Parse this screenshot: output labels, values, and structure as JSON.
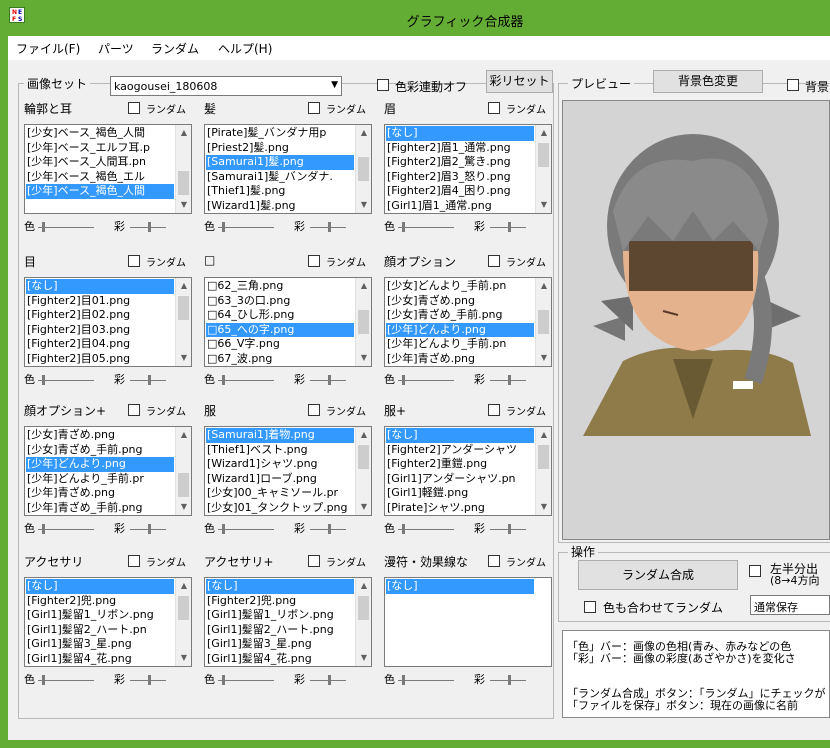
{
  "window": {
    "title": "グラフィック合成器"
  },
  "menu": [
    {
      "label": "ファイル(F)"
    },
    {
      "label": "パーツ"
    },
    {
      "label": "ランダム"
    },
    {
      "label": "ヘルプ(H)"
    }
  ],
  "image_set": {
    "group_title": "画像セット",
    "value": "kaogousei_180608",
    "color_link_label": "色彩連動オフ",
    "saturation_set_button": "彩リセット"
  },
  "random_label": "ランダム",
  "color_label": "色",
  "saturation_label": "彩",
  "parts": [
    {
      "label": "輪郭と耳",
      "items": [
        "[少女]ベース_褐色_人間",
        "[少年]ベース_エルフ耳.p",
        "[少年]ベース_人間耳.pn",
        "[少年]ベース_褐色_エル",
        "[少年]ベース_褐色_人間"
      ],
      "selected": 4,
      "scroll": "bottom"
    },
    {
      "label": "髪",
      "items": [
        "[Pirate]髪_バンダナ用p",
        "[Priest2]髪.png",
        "[Samurai1]髪.png",
        "[Samurai1]髪_バンダナ.",
        "[Thief1]髪.png",
        "[Wizard1]髪.png"
      ],
      "selected": 2,
      "scroll": "mid"
    },
    {
      "label": "眉",
      "items": [
        "[なし]",
        "[Fighter2]眉1_通常.png",
        "[Fighter2]眉2_驚き.png",
        "[Fighter2]眉3_怒り.png",
        "[Fighter2]眉4_困り.png",
        "[Girl1]眉1_通常.png"
      ],
      "selected": 0,
      "scroll": "top"
    },
    {
      "label": "目",
      "items": [
        "[なし]",
        "[Fighter2]目01.png",
        "[Fighter2]目02.png",
        "[Fighter2]目03.png",
        "[Fighter2]目04.png",
        "[Fighter2]目05.png"
      ],
      "selected": 0,
      "scroll": "top"
    },
    {
      "label": "□",
      "items": [
        "□62_三角.png",
        "□63_3の口.png",
        "□64_ひし形.png",
        "□65_への字.png",
        "□66_V字.png",
        "□67_波.png"
      ],
      "selected": 3,
      "scroll": "mid"
    },
    {
      "label": "顔オプション",
      "items": [
        "[少女]どんより_手前.pn",
        "[少女]青ざめ.png",
        "[少女]青ざめ_手前.png",
        "[少年]どんより.png",
        "[少年]どんより_手前.pn",
        "[少年]青ざめ.png"
      ],
      "selected": 3,
      "scroll": "mid"
    },
    {
      "label": "顔オプション+",
      "items": [
        "[少女]青ざめ.png",
        "[少女]青ざめ_手前.png",
        "[少年]どんより.png",
        "[少年]どんより_手前.pr",
        "[少年]青ざめ.png",
        "[少年]青ざめ_手前.png"
      ],
      "selected": 2,
      "scroll": "bottom"
    },
    {
      "label": "服",
      "items": [
        "[Samurai1]着物.png",
        "[Thief1]ベスト.png",
        "[Wizard1]シャツ.png",
        "[Wizard1]ローブ.png",
        "[少女]00_キャミソール.pr",
        "[少女]01_タンクトップ.png"
      ],
      "selected": 0,
      "scroll": "top"
    },
    {
      "label": "服+",
      "items": [
        "[なし]",
        "[Fighter2]アンダーシャツ",
        "[Fighter2]重鎧.png",
        "[Girl1]アンダーシャツ.pn",
        "[Girl1]軽鎧.png",
        "[Pirate]シャツ.png"
      ],
      "selected": 0,
      "scroll": "top"
    },
    {
      "label": "アクセサリ",
      "items": [
        "[なし]",
        "[Fighter2]兜.png",
        "[Girl1]髪留1_リボン.png",
        "[Girl1]髪留2_ハート.pn",
        "[Girl1]髪留3_星.png",
        "[Girl1]髪留4_花.png"
      ],
      "selected": 0,
      "scroll": "top"
    },
    {
      "label": "アクセサリ+",
      "items": [
        "[なし]",
        "[Fighter2]兜.png",
        "[Girl1]髪留1_リボン.png",
        "[Girl1]髪留2_ハート.png",
        "[Girl1]髪留3_星.png",
        "[Girl1]髪留4_花.png"
      ],
      "selected": 0,
      "scroll": "top"
    },
    {
      "label": "漫符・効果線な",
      "items": [
        "[なし]"
      ],
      "selected": 0,
      "scroll": "none"
    }
  ],
  "preview": {
    "group_title": "プレビュー",
    "bg_button": "背景色変更",
    "bg_check_label": "背景"
  },
  "operations": {
    "group_title": "操作",
    "random_button": "ランダム合成",
    "color_random_label": "色も合わせてランダム",
    "split_label_1": "左半分出",
    "split_label_2": "(8→4方向",
    "save_mode": "通常保存"
  },
  "help": [
    "「色」バー：画像の色相(青み、赤みなどの色",
    "「彩」バー：画像の彩度(あざやかさ)を変化さ",
    "",
    "「ランダム合成」ボタン：「ランダム」にチェックが",
    "「ファイルを保存」ボタン：現在の画像に名前"
  ],
  "colors": {
    "titlebar": "#64ad34",
    "selection": "#3399ff",
    "preview_bg": "#d4d4d4"
  }
}
